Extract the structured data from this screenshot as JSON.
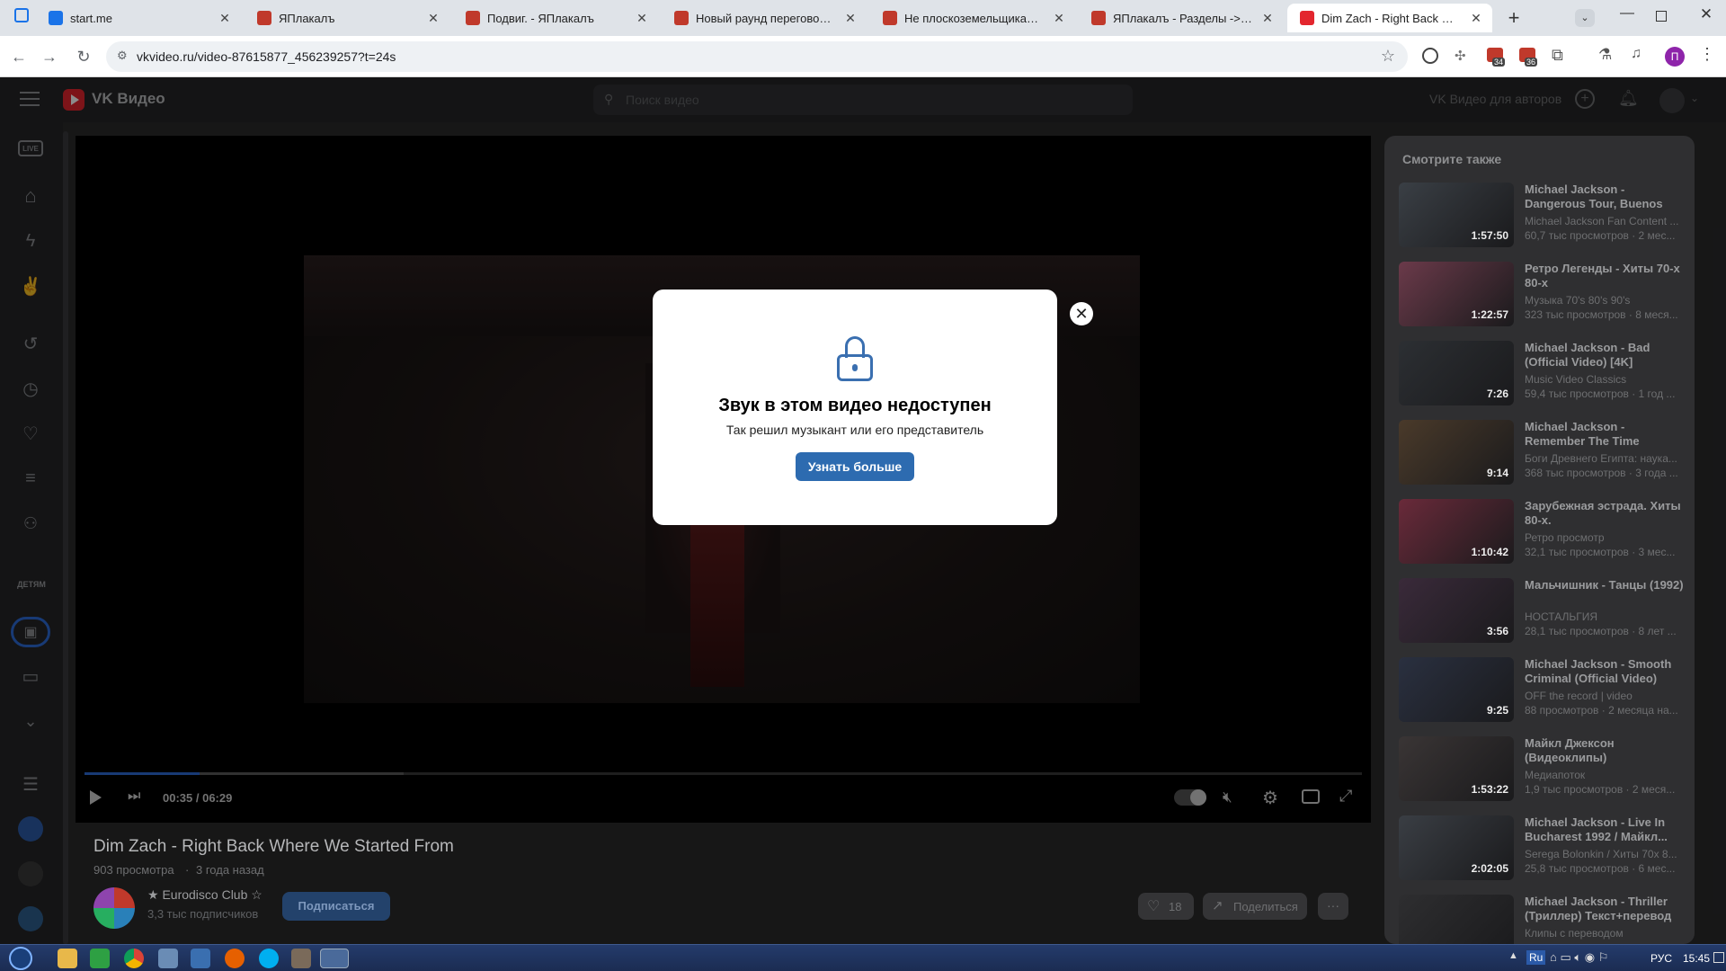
{
  "browser": {
    "tabs": [
      {
        "title": "start.me",
        "color": "#1a73e8"
      },
      {
        "title": "ЯПлакалъ",
        "color": "#c0392b"
      },
      {
        "title": "Подвиг. - ЯПлакалъ",
        "color": "#c0392b"
      },
      {
        "title": "Новый раунд переговоров по",
        "color": "#c0392b"
      },
      {
        "title": "Не плоскоземельщиками ед",
        "color": "#c0392b"
      },
      {
        "title": "ЯПлакалъ - Разделы -> Реда",
        "color": "#c0392b"
      },
      {
        "title": "Dim Zach - Right Back Where",
        "color": "#e3262e"
      }
    ],
    "new_tab": "+",
    "url": "vkvideo.ru/video-87615877_456239257?t=24s",
    "ext_badges": [
      "34",
      "36"
    ],
    "profile_initial": "П"
  },
  "site": {
    "logo": "VK Видео",
    "search_placeholder": "Поиск видео",
    "authors_link": "VK Видео для авторов",
    "live_badge": "LIVE",
    "kids_badge": "ДЕТЯМ"
  },
  "player": {
    "time": "00:35 / 06:29",
    "progress": 0.09,
    "buffered": 0.25
  },
  "modal": {
    "title": "Звук в этом видео недоступен",
    "subtitle": "Так решил музыкант или его представитель",
    "button": "Узнать больше",
    "close": "✕"
  },
  "video": {
    "title": "Dim Zach - Right Back Where We Started From",
    "views": "903 просмотра",
    "age": "3 года назад",
    "channel": "★ Eurodisco Club ☆",
    "subscribers": "3,3 тыс подписчиков",
    "subscribe": "Подписаться",
    "likes": "18",
    "share": "Поделиться",
    "more": "···"
  },
  "related": {
    "heading": "Смотрите также",
    "items": [
      {
        "title": "Michael Jackson - Dangerous Tour, Buenos Aires |...",
        "channel": "Michael Jackson Fan Content ...",
        "stats": "60,7 тыс просмотров · 2 мес...",
        "duration": "1:57:50",
        "bg": "#3a3f45"
      },
      {
        "title": "Ретро Легенды - Хиты 70-х 80-х",
        "channel": "Музыка 70's 80's 90's",
        "stats": "323 тыс просмотров · 8 меся...",
        "duration": "1:22:57",
        "bg": "#6b3a4a"
      },
      {
        "title": "Michael Jackson - Bad (Official Video) [4K]",
        "channel": "Music Video Classics",
        "stats": "59,4 тыс просмотров · 1 год ...",
        "duration": "7:26",
        "bg": "#2c2f33"
      },
      {
        "title": "Michael Jackson - Remember The Time",
        "channel": "Боги Древнего Египта: наука...",
        "stats": "368 тыс просмотров · 3 года ...",
        "duration": "9:14",
        "bg": "#4a3a2a"
      },
      {
        "title": "Зарубежная эстрада. Хиты 80-х.",
        "channel": "Ретро просмотр",
        "stats": "32,1 тыс просмотров · 3 мес...",
        "duration": "1:10:42",
        "bg": "#6a2a3a"
      },
      {
        "title": "Мальчишник - Танцы (1992)",
        "channel": "НОСТАЛЬГИЯ",
        "stats": "28,1 тыс просмотров · 8 лет ...",
        "duration": "3:56",
        "bg": "#3a2a3a"
      },
      {
        "title": "Michael Jackson - Smooth Criminal (Official Video)",
        "channel": "OFF the record | video",
        "stats": "88 просмотров · 2 месяца на...",
        "duration": "9:25",
        "bg": "#2a3040"
      },
      {
        "title": "Майкл Джексон (Видеоклипы)",
        "channel": "Медиапоток",
        "stats": "1,9 тыс просмотров · 2 меся...",
        "duration": "1:53:22",
        "bg": "#3a3535"
      },
      {
        "title": "Michael Jackson - Live In Bucharest 1992 / Майкл...",
        "channel": "Serega Bolonkin / Хиты 70х 8...",
        "stats": "25,8 тыс просмотров · 6 мес...",
        "duration": "2:02:05",
        "bg": "#3a3e44"
      },
      {
        "title": "Michael Jackson - Thriller (Триллер) Текст+перевод",
        "channel": "Клипы с переводом",
        "stats": "",
        "duration": "",
        "bg": "#2e2e30"
      }
    ]
  },
  "taskbar": {
    "lang": "Ru",
    "lang2": "РУС",
    "clock": "15:45"
  }
}
